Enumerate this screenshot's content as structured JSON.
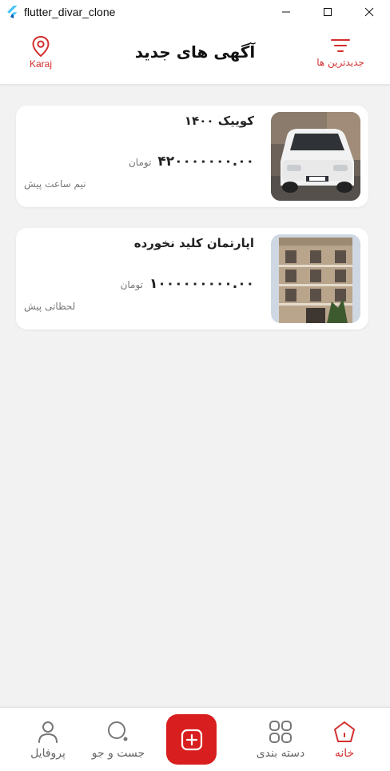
{
  "window": {
    "title": "flutter_divar_clone"
  },
  "appbar": {
    "title": "آگهی های جدید",
    "location_label": "Karaj",
    "sort_label": "جدیدترین ها",
    "accent_color": "#d32f2f"
  },
  "listings": [
    {
      "title": "کوییک ۱۴۰۰",
      "price": "۴۲۰۰۰۰۰۰۰.۰۰",
      "currency": "تومان",
      "time": "نیم ساعت پیش",
      "image": "white-car-photo"
    },
    {
      "title": "اپارتمان کلید نخورده",
      "price": "۱۰۰۰۰۰۰۰۰۰.۰۰",
      "currency": "تومان",
      "time": "لحظاتی پیش",
      "image": "apartment-building-photo"
    }
  ],
  "bottom_nav": {
    "home": "خانه",
    "categories": "دسته بندی",
    "add": "plus-icon",
    "search": "جست و جو",
    "profile": "پروفایل",
    "active": "home"
  }
}
